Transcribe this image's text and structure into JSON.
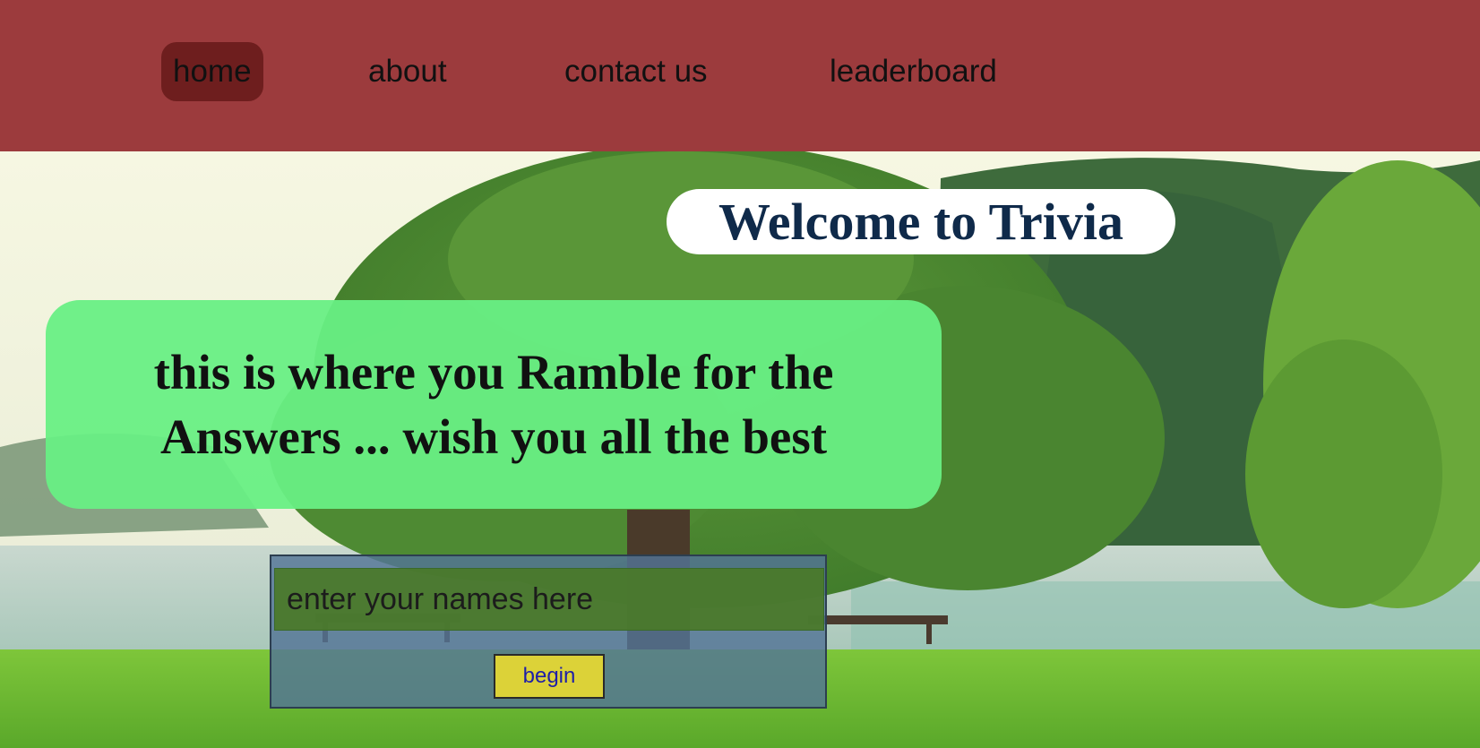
{
  "nav": {
    "items": [
      {
        "label": "home",
        "active": true
      },
      {
        "label": "about",
        "active": false
      },
      {
        "label": "contact us",
        "active": false
      },
      {
        "label": "leaderboard",
        "active": false
      }
    ]
  },
  "hero": {
    "welcome_title": "Welcome to Trivia",
    "message": "this is where you Ramble for the Answers ... wish you all the best"
  },
  "form": {
    "name_placeholder": "enter your names here",
    "name_value": "",
    "begin_label": "begin"
  },
  "colors": {
    "navbar_bg": "#9c3b3d",
    "nav_active_bg": "#6e1e1e",
    "welcome_text": "#0f2a4a",
    "message_bg": "#68ef84",
    "begin_button_bg": "#dcd238",
    "begin_button_text": "#1e1ea8"
  }
}
